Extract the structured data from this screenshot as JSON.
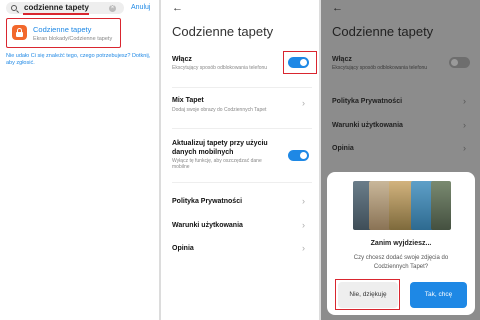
{
  "search": {
    "query": "codzienne tapety",
    "clear_glyph": "×",
    "cancel_label": "Anuluj",
    "result": {
      "title": "Codzienne tapety",
      "subtitle": "Ekran blokady/Codzienne tapety"
    },
    "help_text": "Nie udało Ci się znaleźć tego, czego potrzebujesz? Dotknij, aby zgłosić."
  },
  "settings": {
    "back_glyph": "←",
    "title": "Codzienne tapety",
    "enable": {
      "label": "Włącz",
      "desc": "Ekscytujący sposób odblokowania telefonu",
      "on": true
    },
    "mix": {
      "label": "Mix Tapet",
      "desc": "Dodaj swoje obrazy do Codziennych Tapet"
    },
    "mobile_data": {
      "label_line1": "Aktualizuj tapety przy użyciu",
      "label_line2": "danych mobilnych",
      "desc_line1": "Wyłącz tę funkcję, aby oszczędzać dane",
      "desc_line2": "mobilne",
      "on": true
    },
    "privacy": "Polityka Prywatności",
    "terms": "Warunki użytkowania",
    "opinion": "Opinia",
    "chevron_glyph": "›"
  },
  "dialog": {
    "title": "Zanim wyjdziesz...",
    "text_line1": "Czy chcesz dodać swoje zdjęcia do",
    "text_line2": "Codziennych Tapet?",
    "no_label": "Nie, dziękuję",
    "yes_label": "Tak, chcę"
  },
  "colors": {
    "accent": "#1e88e5",
    "highlight": "#d9262f",
    "app_icon": "#f2682c"
  }
}
